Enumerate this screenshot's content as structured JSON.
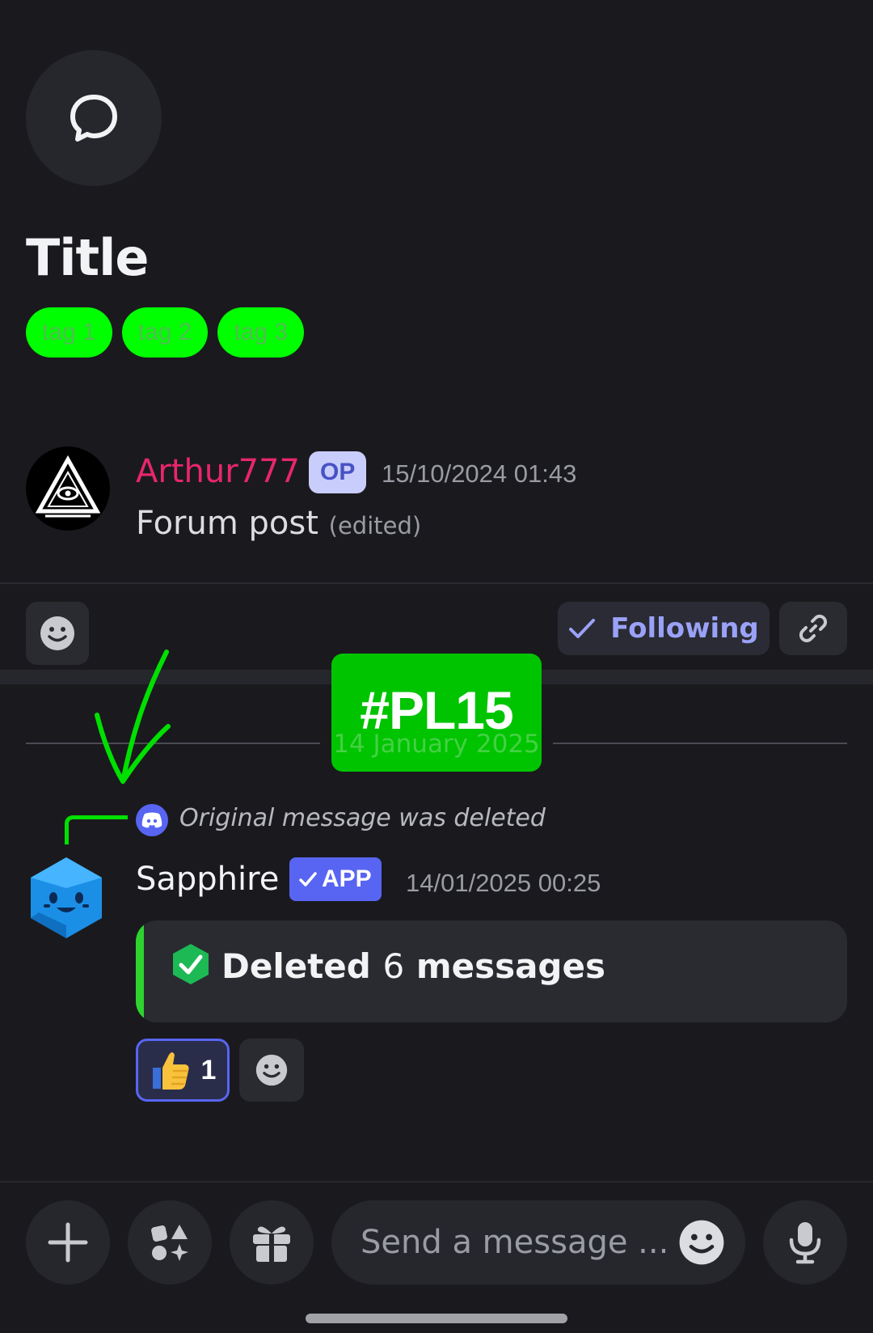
{
  "header": {
    "icon": "chat-bubble-icon",
    "title": "Title",
    "tags": [
      "tag 1",
      "tag 2",
      "tag 3"
    ]
  },
  "post": {
    "author": "Arthur777",
    "badge": "OP",
    "timestamp": "15/10/2024 01:43",
    "content": "Forum post",
    "edited_label": "(edited)"
  },
  "actions": {
    "following_label": "Following",
    "reaction_icon": "smile-icon",
    "link_icon": "link-icon"
  },
  "separator": {
    "date": "14 January 2025",
    "overlay_label": "#PL15"
  },
  "reply": {
    "reference_text": "Original message was deleted",
    "author": "Sapphire",
    "badge": "APP",
    "timestamp": "14/01/2025 00:25",
    "embed": {
      "prefix": "Deleted",
      "count": "6",
      "suffix": "messages"
    },
    "reactions": [
      {
        "emoji": "👍",
        "count": "1"
      }
    ]
  },
  "composer": {
    "placeholder": "Send a message ...",
    "buttons": [
      "plus-icon",
      "apps-icon",
      "gift-icon",
      "mic-icon"
    ]
  },
  "colors": {
    "background": "#1a1a1e",
    "accent": "#5865f2",
    "op_name": "#e8266b",
    "tag": "#00ff00",
    "sticker": "#00c400"
  }
}
